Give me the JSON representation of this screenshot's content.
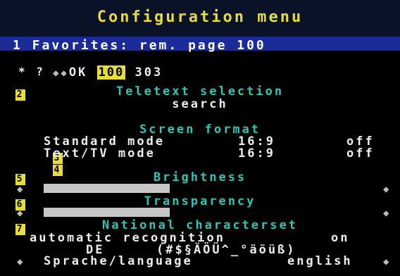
{
  "menu": {
    "title": "Configuration menu",
    "favorites_row": "1 Favorites: rem. page 100",
    "ok_row": {
      "arrows": "◆◆",
      "ok_label": "OK",
      "page": "100",
      "page2": "303"
    },
    "question_row": "* ?",
    "teletext": {
      "number": "2",
      "heading": "Teletext selection",
      "value": "search"
    },
    "screen_format": {
      "heading": "Screen format",
      "items": [
        {
          "number": "3",
          "label": "Standard mode",
          "ratio": "16:9",
          "value": "off"
        },
        {
          "number": "4",
          "label": "Text/TV mode",
          "ratio": "16:9",
          "value": "off"
        }
      ]
    },
    "brightness": {
      "number": "5",
      "heading": "Brightness",
      "level": 0.38
    },
    "transparency": {
      "number": "6",
      "heading": "Transparency",
      "level": 0.38
    },
    "national": {
      "number": "7",
      "heading": "National characterset",
      "auto_label": "automatic recognition",
      "auto_value": "on",
      "charset_lang": "DE",
      "charset_chars": "(#$§ÄÖÜ^_°äöüß)",
      "language_label": "Sprache/language",
      "language_value": "english"
    }
  }
}
